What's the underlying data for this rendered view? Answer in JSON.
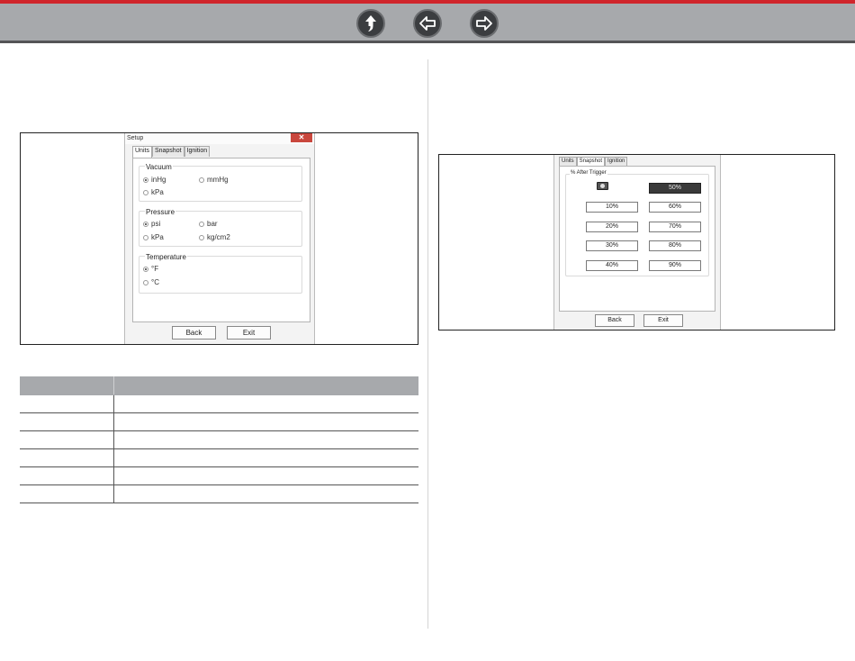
{
  "nav": {
    "buttons": [
      {
        "name": "home",
        "icon": "up-arrow-icon"
      },
      {
        "name": "back",
        "icon": "left-arrow-icon"
      },
      {
        "name": "forward",
        "icon": "right-arrow-icon"
      }
    ],
    "accent_color": "#d0252b"
  },
  "units_dialog": {
    "title": "Setup",
    "close_label": "✕",
    "tabs": [
      "Units",
      "Snapshot",
      "Ignition"
    ],
    "vacuum": {
      "label": "Vacuum",
      "options": [
        "inHg",
        "mmHg",
        "kPa"
      ],
      "selected": "inHg"
    },
    "pressure": {
      "label": "Pressure",
      "options": [
        "psi",
        "bar",
        "kPa",
        "kg/cm2"
      ],
      "selected": "psi"
    },
    "temperature": {
      "label": "Temperature",
      "options": [
        "°F",
        "°C"
      ],
      "selected": "°F"
    },
    "back_label": "Back",
    "exit_label": "Exit"
  },
  "snapshot_dialog": {
    "tabs": [
      "Units",
      "Snapshot",
      "Ignition"
    ],
    "group_label": "% After Trigger",
    "left_column": [
      "10%",
      "20%",
      "30%",
      "40%"
    ],
    "right_column": [
      "50%",
      "60%",
      "70%",
      "80%",
      "90%"
    ],
    "selected": "50%",
    "back_label": "Back",
    "exit_label": "Exit"
  },
  "table": {
    "header": [
      "",
      ""
    ],
    "rows": [
      [
        "",
        ""
      ],
      [
        "",
        ""
      ],
      [
        "",
        ""
      ],
      [
        "",
        ""
      ],
      [
        "",
        ""
      ],
      [
        "",
        ""
      ]
    ]
  }
}
